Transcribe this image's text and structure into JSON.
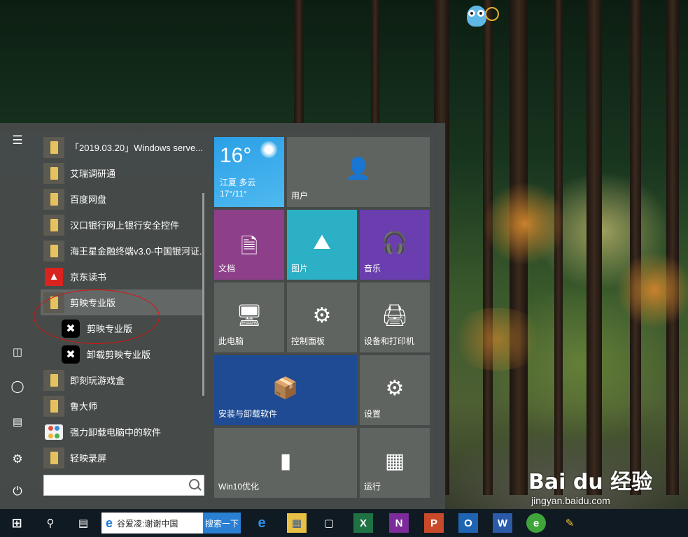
{
  "start_menu": {
    "apps": [
      {
        "label": "「2019.03.20」Windows serve...",
        "icon": "folder-icon"
      },
      {
        "label": "艾瑞调研通",
        "icon": "folder-icon"
      },
      {
        "label": "百度网盘",
        "icon": "folder-icon"
      },
      {
        "label": "汉口银行网上银行安全控件",
        "icon": "folder-icon"
      },
      {
        "label": "海王星金融终端v3.0-中国银河证...",
        "icon": "folder-icon"
      },
      {
        "label": "京东读书",
        "icon": "jd-read-icon"
      },
      {
        "label": "剪映专业版",
        "icon": "folder-icon"
      },
      {
        "label": "剪映专业版",
        "icon": "capcut-icon"
      },
      {
        "label": "卸载剪映专业版",
        "icon": "capcut-icon"
      },
      {
        "label": "即刻玩游戏盒",
        "icon": "folder-icon"
      },
      {
        "label": "鲁大师",
        "icon": "folder-icon"
      },
      {
        "label": "强力卸载电脑中的软件",
        "icon": "uninstaller-icon"
      },
      {
        "label": "轻映录屏",
        "icon": "folder-icon"
      }
    ],
    "rail": [
      "hamburger-icon",
      "document-icon",
      "user-icon",
      "pictures-icon",
      "settings-icon",
      "power-icon"
    ],
    "search": {
      "placeholder": ""
    }
  },
  "tiles": {
    "weather": {
      "temp": "16°",
      "city": "江夏 多云",
      "range": "17°/11°"
    },
    "user": "用户",
    "documents": "文档",
    "pictures": "图片",
    "music": "音乐",
    "this_pc": "此电脑",
    "control_panel": "控制面板",
    "devices_printers": "设备和打印机",
    "install_uninstall": "安装与卸载软件",
    "settings": "设置",
    "win10": "Win10优化",
    "run": "运行"
  },
  "taskbar": {
    "search_box_text": "谷爱凌:谢谢中国",
    "search_button": "搜索一下",
    "icons": [
      "windows-start-icon",
      "search-icon",
      "task-view-icon",
      "edge-icon",
      "file-explorer-icon",
      "store-icon",
      "excel-icon",
      "onenote-icon",
      "powerpoint-icon",
      "outlook-icon",
      "word-icon",
      "360-icon",
      "paint-icon"
    ]
  },
  "watermark": {
    "logo": "Bai du 经验",
    "url": "jingyan.baidu.com"
  },
  "colors": {
    "weather": "#2ba0e6",
    "documents": "#8e3f8a",
    "pictures": "#2cb0c5",
    "music": "#6a3eaf",
    "install": "#1e4b93"
  }
}
